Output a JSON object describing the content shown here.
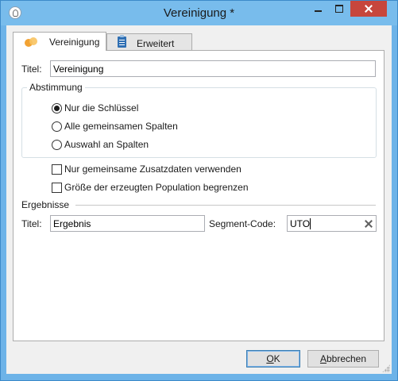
{
  "window": {
    "title": "Vereinigung *"
  },
  "tabs": [
    {
      "label": "Vereinigung",
      "icon": "union-circles-icon",
      "active": true
    },
    {
      "label": "Erweitert",
      "icon": "clipboard-icon",
      "active": false
    }
  ],
  "form": {
    "title_label": "Titel:",
    "title_value": "Vereinigung",
    "matching": {
      "caption": "Abstimmung",
      "options": [
        {
          "label": "Nur die Schlüssel",
          "checked": true
        },
        {
          "label": "Alle gemeinsamen Spalten",
          "checked": false
        },
        {
          "label": "Auswahl an Spalten",
          "checked": false
        }
      ]
    },
    "checkboxes": [
      {
        "label": "Nur gemeinsame Zusatzdaten verwenden",
        "checked": false
      },
      {
        "label": "Größe der erzeugten Population begrenzen",
        "checked": false
      }
    ],
    "results": {
      "caption": "Ergebnisse",
      "title_label": "Titel:",
      "title_value": "Ergebnis",
      "segment_label": "Segment-Code:",
      "segment_value": "UTO"
    }
  },
  "buttons": {
    "ok": {
      "mnemonic": "O",
      "rest": "K"
    },
    "cancel": {
      "mnemonic": "A",
      "rest": "bbrechen"
    }
  },
  "colors": {
    "titlebar": "#78bcec",
    "close_button": "#c7463c",
    "default_button_border": "#3c7fb1"
  }
}
